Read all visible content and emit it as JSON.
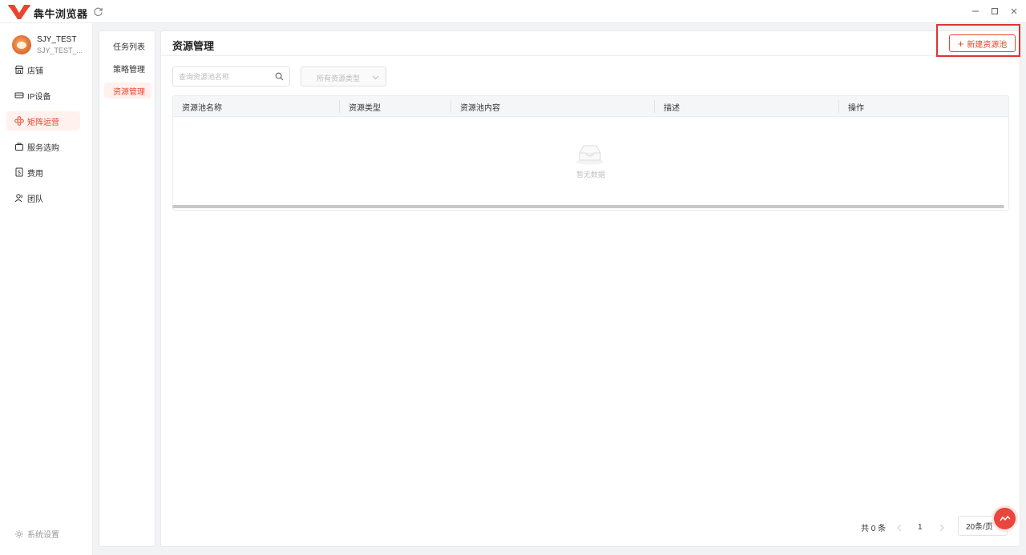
{
  "app": {
    "name": "犇牛浏览器",
    "brand_color": "#e8452e"
  },
  "user": {
    "name": "SJY_TEST",
    "sub": "SJY_TEST_..."
  },
  "sidebar": {
    "items": [
      {
        "label": "店铺",
        "icon": "store-icon"
      },
      {
        "label": "IP设备",
        "icon": "ip-device-icon"
      },
      {
        "label": "矩阵运营",
        "icon": "matrix-icon",
        "active": true
      },
      {
        "label": "服务选购",
        "icon": "shopping-bag-icon"
      },
      {
        "label": "费用",
        "icon": "fee-icon"
      },
      {
        "label": "团队",
        "icon": "team-icon"
      }
    ],
    "settings_label": "系统设置"
  },
  "subnav": {
    "items": [
      {
        "label": "任务列表"
      },
      {
        "label": "策略管理"
      },
      {
        "label": "资源管理",
        "active": true
      }
    ]
  },
  "main": {
    "title": "资源管理",
    "new_button_label": "新建资源池",
    "search_placeholder": "查询资源池名称",
    "type_select_value": "所有资源类型",
    "table": {
      "columns": [
        "资源池名称",
        "资源类型",
        "资源池内容",
        "描述",
        "操作"
      ],
      "rows": [],
      "empty_text": "暂无数据"
    },
    "pagination": {
      "total_text": "共 0 条",
      "current_page": "1",
      "page_size": "20条/页"
    }
  }
}
